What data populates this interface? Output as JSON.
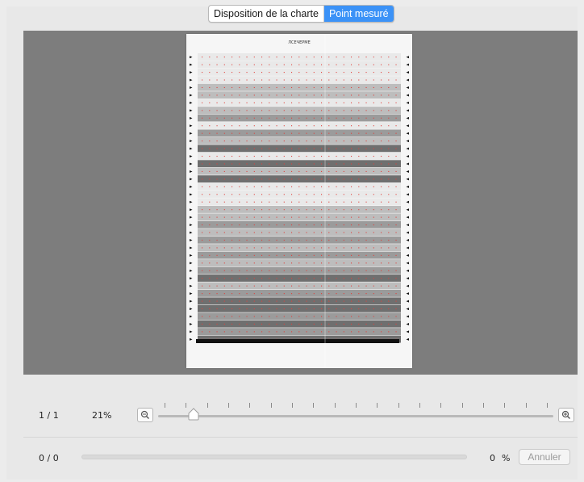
{
  "tabs": [
    {
      "label": "Disposition de la charte",
      "active": false
    },
    {
      "label": "Point mesuré",
      "active": true
    }
  ],
  "preview": {
    "page_header_text": "ЛСЕЧЕРМЕ",
    "row_pattern": "strips of gray patches with red measurement points"
  },
  "zoom": {
    "page_counter": "1 / 1",
    "zoom_level": "21%",
    "slider_fraction": 0.09,
    "zoom_out_icon": "magnifier-minus-icon",
    "zoom_in_icon": "magnifier-plus-icon"
  },
  "progress": {
    "counter": "0 / 0",
    "percent_value": "0",
    "percent_sign": "%",
    "fraction": 0,
    "cancel_label": "Annuler"
  },
  "colors": {
    "accent": "#3b92f7",
    "viewer_bg": "#7d7d7d",
    "measure_point": "#e2413c"
  }
}
